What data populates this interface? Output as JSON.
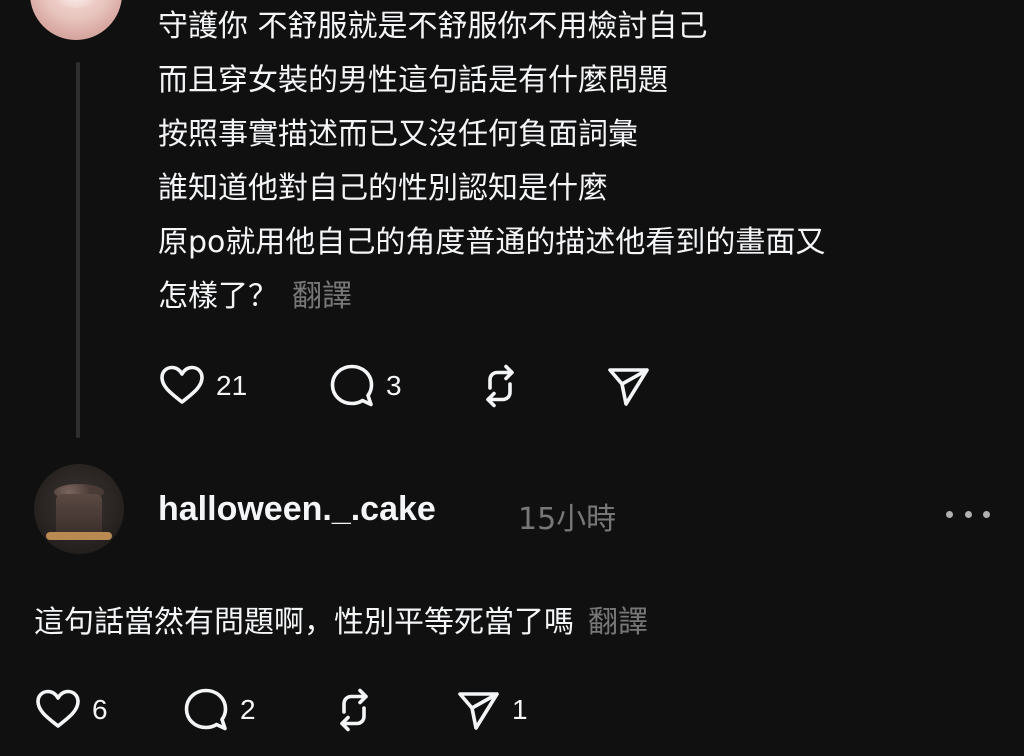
{
  "post1": {
    "lines": [
      "守護你 不舒服就是不舒服你不用檢討自己",
      "而且穿女裝的男性這句話是有什麼問題",
      "按照事實描述而已又沒任何負面詞彙",
      "誰知道他對自己的性別認知是什麼",
      "原po就用他自己的角度普通的描述他看到的畫面又",
      "怎樣了？"
    ],
    "translate_label": "翻譯",
    "likes": "21",
    "replies": "3"
  },
  "post2": {
    "username": "halloween._.cake",
    "timestamp": "15小時",
    "text": "這句話當然有問題啊，性別平等死當了嗎",
    "translate_label": "翻譯",
    "likes": "6",
    "replies": "2",
    "shares": "1"
  },
  "icons": {
    "like": "heart-icon",
    "reply": "speech-bubble-icon",
    "repost": "repost-icon",
    "share": "send-icon",
    "more": "more-dots-icon"
  },
  "colors": {
    "background": "#101010",
    "text": "#f3f5f7",
    "muted": "#777777",
    "thread_line": "#2f2f2f"
  }
}
